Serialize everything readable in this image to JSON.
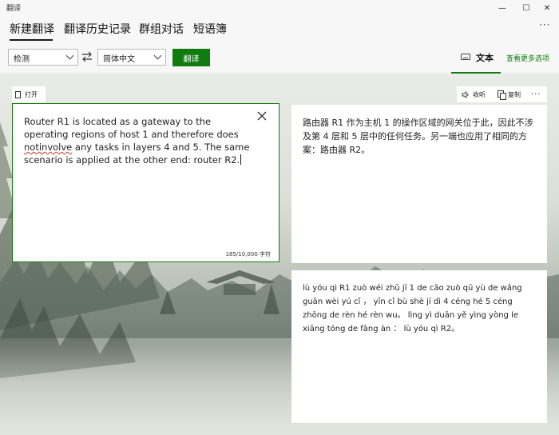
{
  "window": {
    "title": "翻译",
    "min_glyph": "—",
    "max_glyph": "☐",
    "close_glyph": "✕"
  },
  "nav": {
    "tabs": [
      {
        "label": "新建翻译"
      },
      {
        "label": "翻译历史记录"
      },
      {
        "label": "群组对话"
      },
      {
        "label": "短语簿"
      }
    ],
    "more": "···"
  },
  "toolbar": {
    "source_lang": "检测",
    "target_lang": "简体中文",
    "translate_label": "翻译",
    "text_tab_label": "文本",
    "more_options_label": "查看更多选项"
  },
  "source": {
    "open_label": "打开",
    "text_before": "Router R1 is located as a gateway to the operating regions of host 1 and therefore does ",
    "text_misspelled": "notinvolve",
    "text_after": " any tasks in layers 4 and 5. The same scenario is applied at the other end: router R2.",
    "char_count": "185/10,000 字符"
  },
  "result": {
    "listen_label": "收听",
    "copy_label": "复制",
    "more": "···",
    "translation": "路由器 R1 作为主机 1 的操作区域的网关位于此，因此不涉及第 4 层和 5 层中的任何任务。另一端也应用了相同的方案：路由器 R2。",
    "pinyin": "lù yóu qì R1 zuò wéi zhǔ jī 1 de cāo zuò qū yù de wǎng guān wèi yú cǐ ， yīn cǐ bù shè jí dì 4 céng hé 5 céng zhōng de rèn hé rèn wu。 lìng yì duān yě yìng yòng le xiāng tóng de fāng àn ： lù yóu qì R2。"
  },
  "colors": {
    "accent": "#107c10",
    "misspell": "#d13438"
  },
  "icons": [
    "swap-icon",
    "keyboard-icon",
    "document-icon",
    "close-icon",
    "speaker-icon",
    "copy-icon",
    "more-icon"
  ]
}
